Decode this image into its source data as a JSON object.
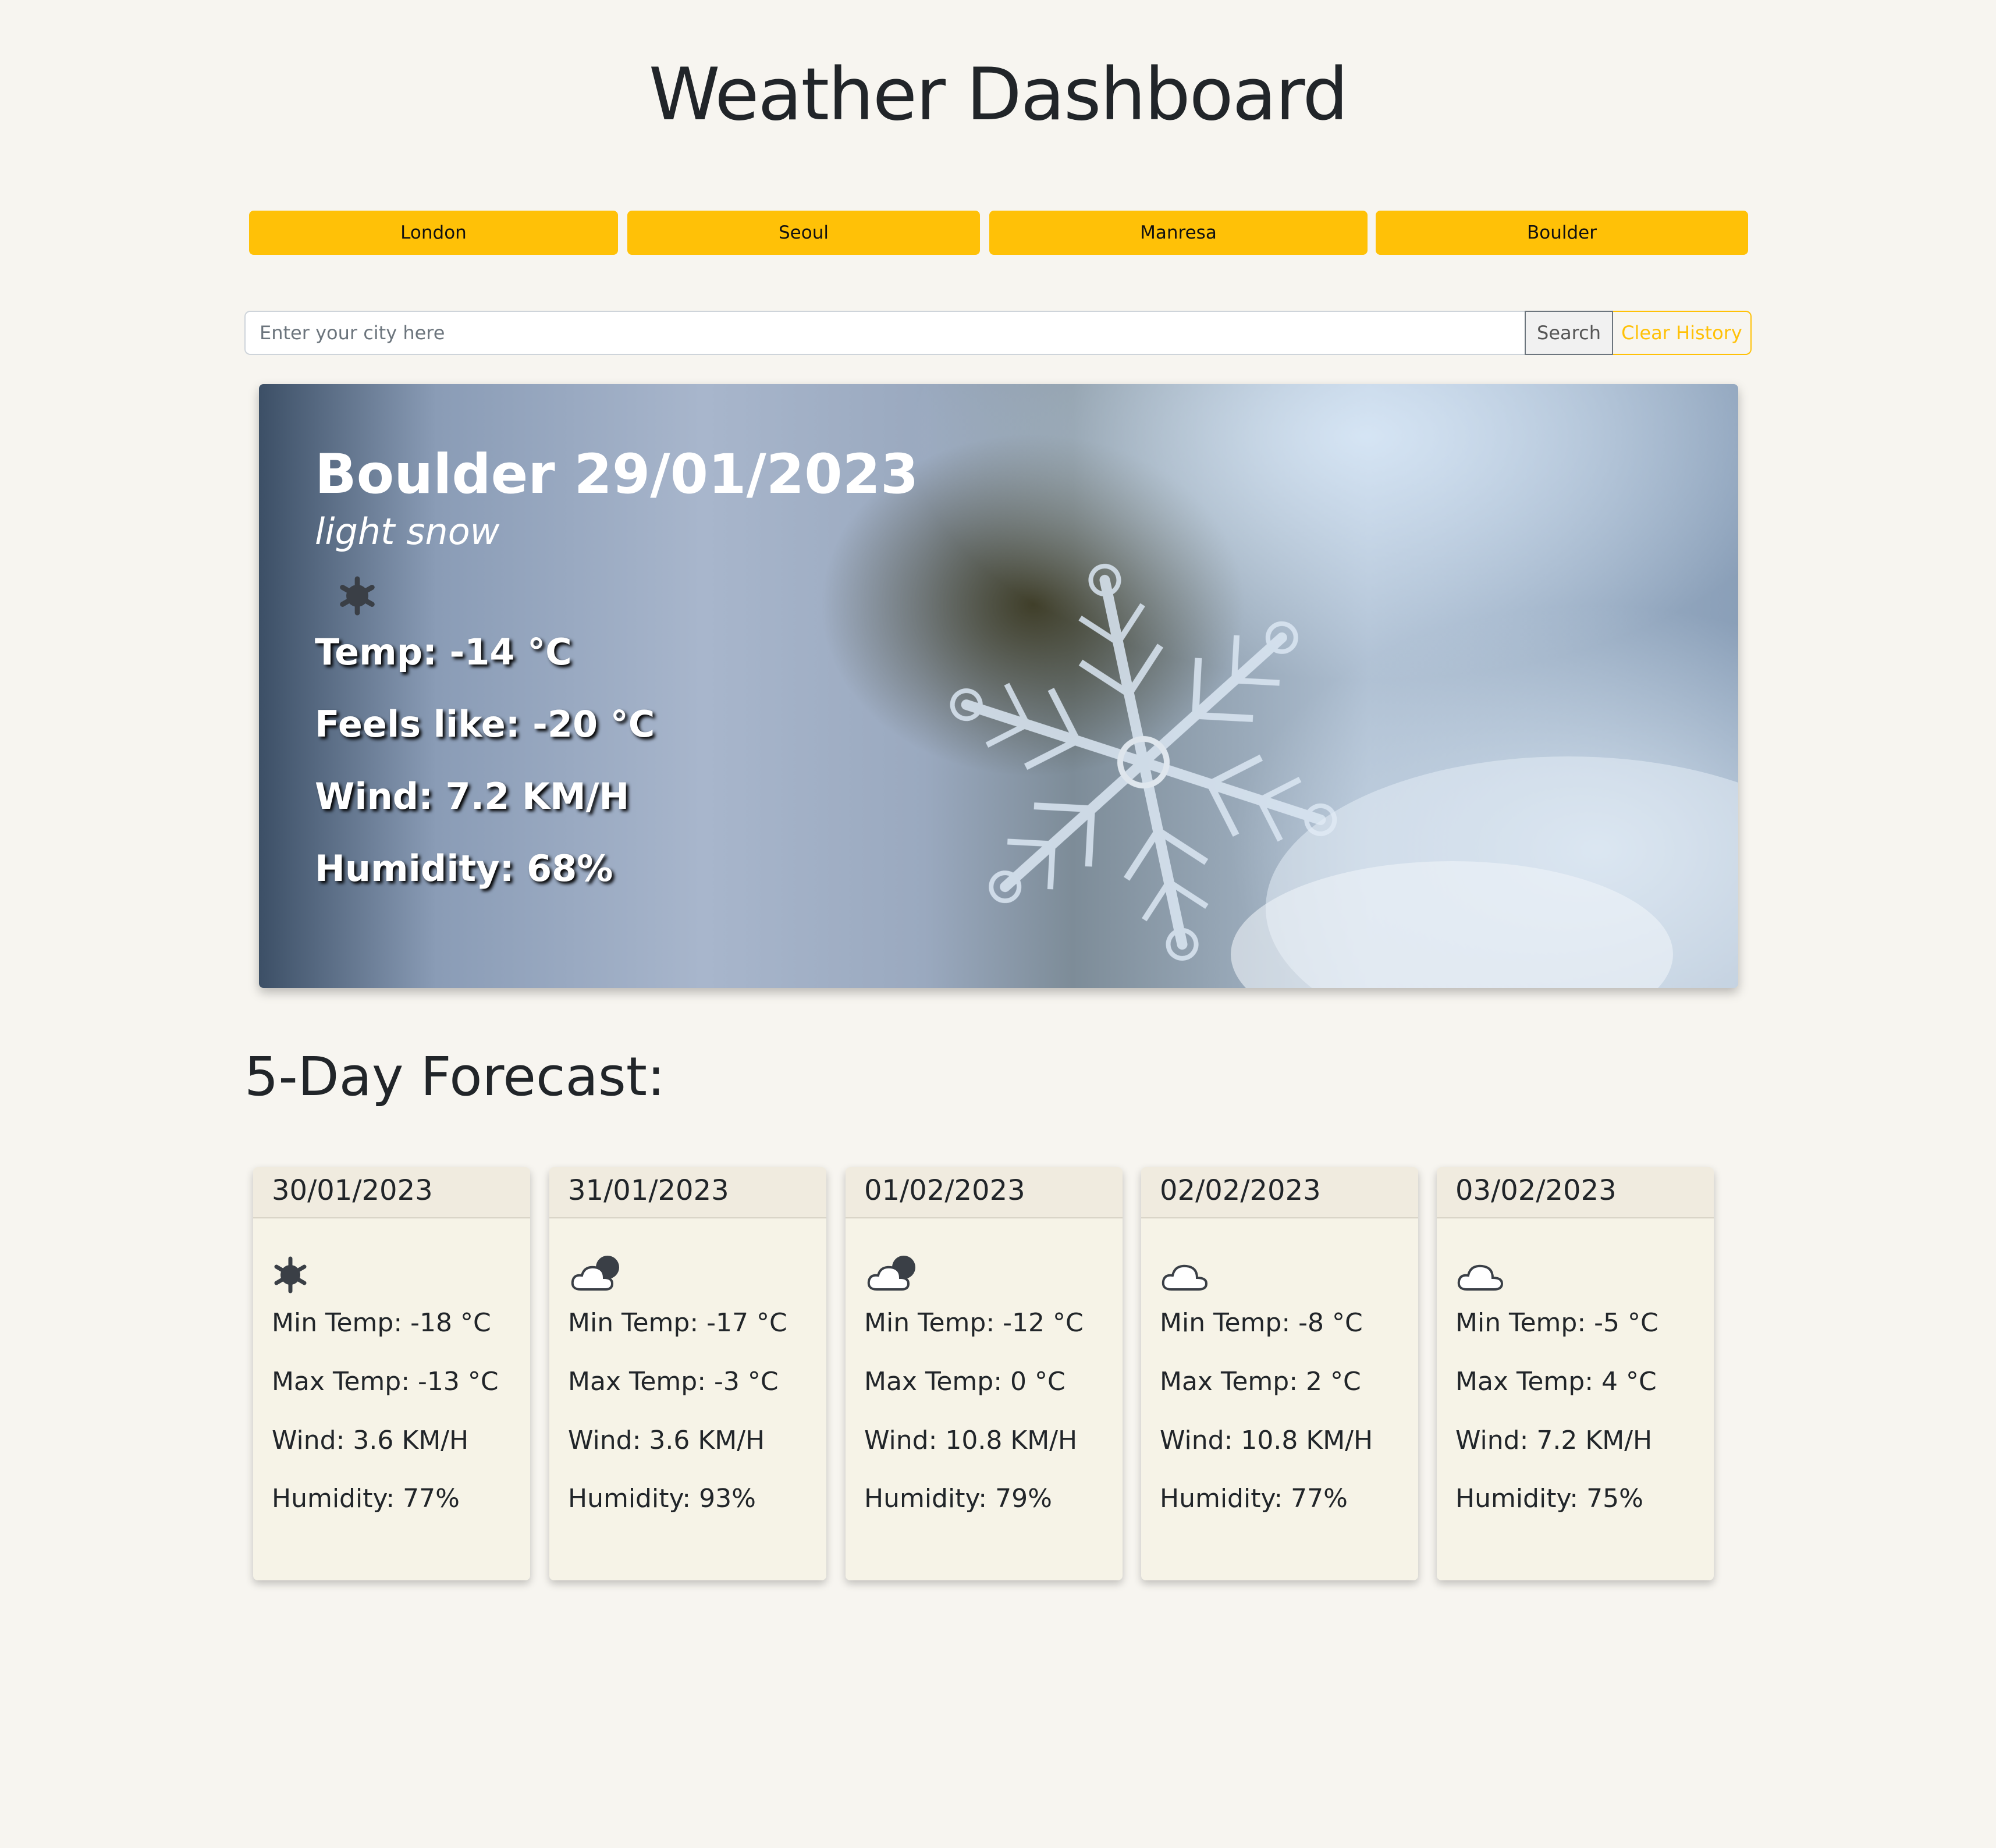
{
  "title": "Weather Dashboard",
  "history": [
    "London",
    "Seoul",
    "Manresa",
    "Boulder"
  ],
  "search": {
    "placeholder": "Enter your city here",
    "value": "",
    "search_label": "Search",
    "clear_label": "Clear History"
  },
  "current": {
    "city_date": "Boulder 29/01/2023",
    "description": "light snow",
    "icon": "snowflake-icon",
    "temp": "Temp: -14 °C",
    "feels_like": "Feels like: -20 °C",
    "wind": "Wind: 7.2 KM/H",
    "humidity": "Humidity: 68%"
  },
  "forecast_heading": "5-Day Forecast:",
  "forecast": [
    {
      "date": "30/01/2023",
      "icon": "snowflake-icon",
      "min": "Min Temp: -18 °C",
      "max": "Max Temp: -13 °C",
      "wind": "Wind: 3.6 KM/H",
      "humidity": "Humidity: 77%"
    },
    {
      "date": "31/01/2023",
      "icon": "cloud-moon-icon",
      "min": "Min Temp: -17 °C",
      "max": "Max Temp: -3 °C",
      "wind": "Wind: 3.6 KM/H",
      "humidity": "Humidity: 93%"
    },
    {
      "date": "01/02/2023",
      "icon": "cloud-moon-icon",
      "min": "Min Temp: -12 °C",
      "max": "Max Temp: 0 °C",
      "wind": "Wind: 10.8 KM/H",
      "humidity": "Humidity: 79%"
    },
    {
      "date": "02/02/2023",
      "icon": "cloud-icon",
      "min": "Min Temp: -8 °C",
      "max": "Max Temp: 2 °C",
      "wind": "Wind: 10.8 KM/H",
      "humidity": "Humidity: 77%"
    },
    {
      "date": "03/02/2023",
      "icon": "cloud-icon",
      "min": "Min Temp: -5 °C",
      "max": "Max Temp: 4 °C",
      "wind": "Wind: 7.2 KM/H",
      "humidity": "Humidity: 75%"
    }
  ],
  "colors": {
    "accent": "#ffc107",
    "background": "#f7f5f0",
    "card": "#f6f3e7"
  }
}
